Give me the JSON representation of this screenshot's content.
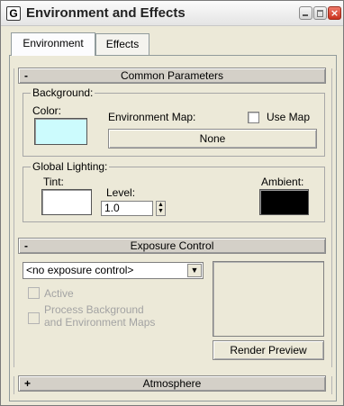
{
  "window": {
    "title": "Environment and Effects",
    "icon_letter": "G",
    "close_glyph": "×"
  },
  "tabs": [
    {
      "label": "Environment",
      "active": true
    },
    {
      "label": "Effects",
      "active": false
    }
  ],
  "common_parameters": {
    "toggle": "-",
    "title": "Common Parameters",
    "background": {
      "group_label": "Background:",
      "color_label": "Color:",
      "color_value": "#ccfbfd",
      "env_map_label": "Environment Map:",
      "use_map_label": "Use Map",
      "use_map_checked": false,
      "map_button_label": "None"
    },
    "global_lighting": {
      "group_label": "Global Lighting:",
      "tint_label": "Tint:",
      "tint_value": "#ffffff",
      "level_label": "Level:",
      "level_value": "1.0",
      "ambient_label": "Ambient:",
      "ambient_value": "#000000"
    }
  },
  "exposure_control": {
    "toggle": "-",
    "title": "Exposure Control",
    "selected_option": "<no exposure control>",
    "active_label": "Active",
    "active_checked": false,
    "process_label_line1": "Process Background",
    "process_label_line2": "and Environment Maps",
    "process_checked": false,
    "render_preview_label": "Render Preview"
  },
  "atmosphere": {
    "toggle": "+",
    "title": "Atmosphere"
  }
}
